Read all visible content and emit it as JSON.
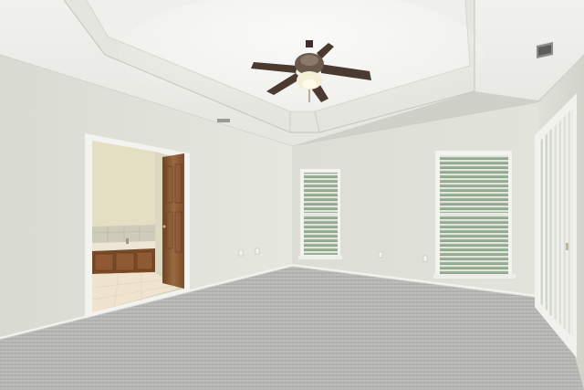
{
  "scene": {
    "subject": "empty-bedroom",
    "colors": {
      "wall_light": "#e2e3db",
      "wall_shade": "#cfd0c6",
      "ceiling": "#eceee8",
      "carpet": "#b7b8b6",
      "door_wood": "#8a5a35",
      "cabinet_wood": "#7a4a28",
      "window_glass": "#9fb39a",
      "fan_blade": "#4a3a30"
    },
    "icons": [
      "ceiling-fan-icon",
      "air-vent-icon"
    ]
  }
}
